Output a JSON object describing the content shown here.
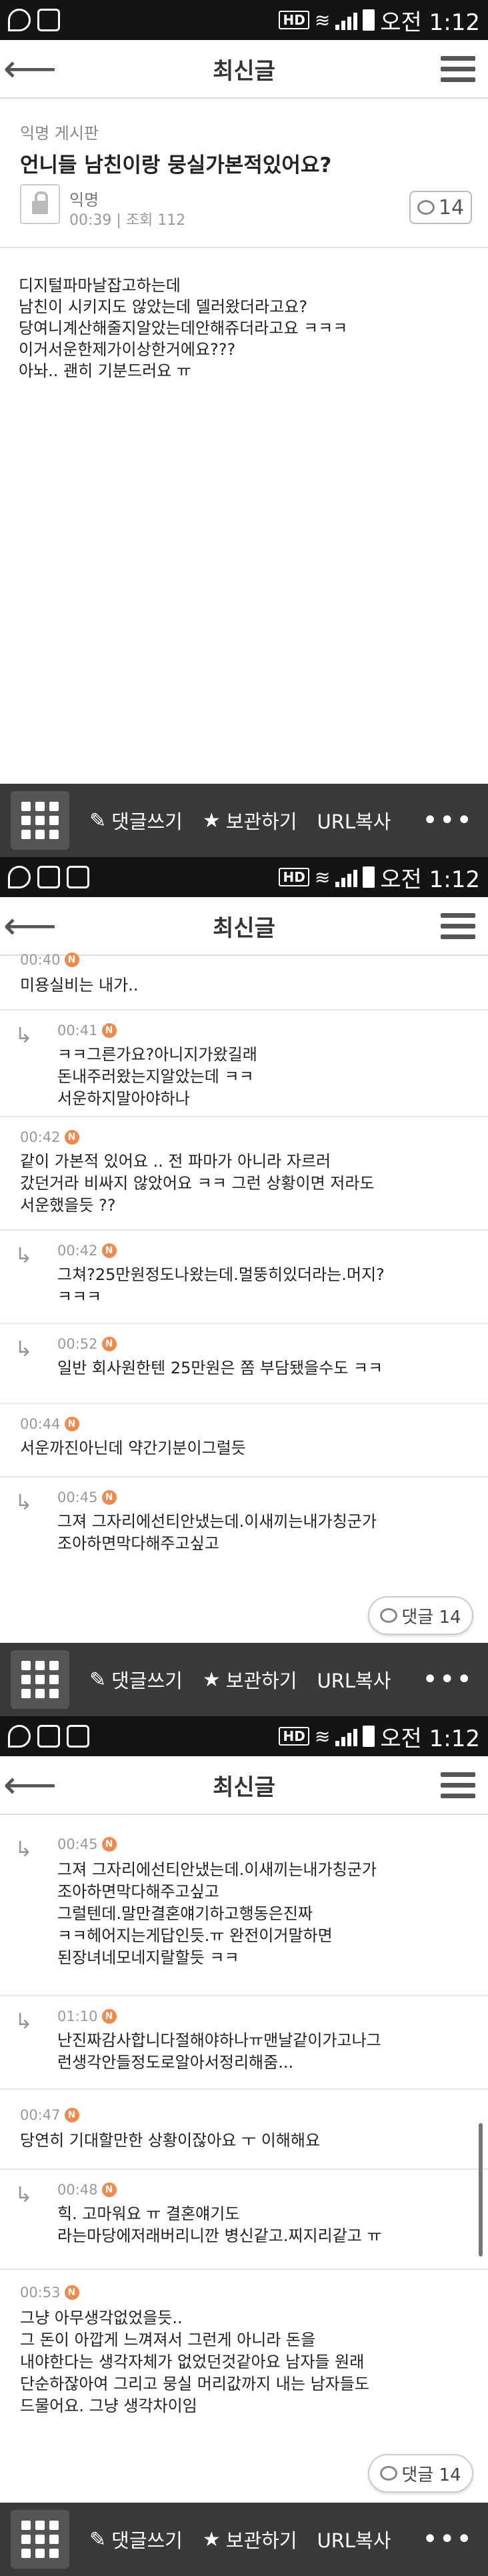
{
  "status": {
    "time": "오전 1:12",
    "hd": "HD"
  },
  "appbar": {
    "title": "최신글"
  },
  "bottombar": {
    "comment": "댓글쓰기",
    "bookmark": "보관하기",
    "url_copy": "URL복사",
    "more": "•••"
  },
  "post": {
    "board": "익명 게시판",
    "title": "언니들 남친이랑 뭉실가본적있어요?",
    "author": "익명",
    "time": "00:39",
    "views": "조회 112",
    "comment_count": "14",
    "body": "디지털파마날잡고하는데\n남친이 시키지도 않았는데 델러왔더라고요?\n당여니계산해줄지알았는데안해쥬더라고요 ㅋㅋㅋ\n이거서운한제가이상한거에요???\n아놔.. 괜히 기분드러요 ㅠ"
  },
  "screen2": {
    "partial_time": "00:40",
    "partial_text": "미용실비는 내가..",
    "comments": [
      {
        "reply": true,
        "time": "00:41",
        "text": "ㅋㅋ그른가요?아니지가왔길래\n돈내주러왔는지알았는데 ㅋㅋ\n서운하지말아야하나"
      },
      {
        "reply": false,
        "time": "00:42",
        "text": "같이 가본적 있어요 .. 전 파마가 아니라 자르러\n갔던거라 비싸지 않았어요 ㅋㅋ 그런 상황이면 저라도\n서운했을듯 ??"
      },
      {
        "reply": true,
        "time": "00:42",
        "text": "그쳐?25만원정도나왔는데.멀뚱히있더라는.머지?\nㅋㅋㅋ"
      },
      {
        "reply": true,
        "time": "00:52",
        "text": "일반 회사원한텐 25만원은 쫌 부담됐을수도 ㅋㅋ"
      },
      {
        "reply": false,
        "time": "00:44",
        "text": "서운까진아닌데 약간기분이그럴듯"
      },
      {
        "reply": true,
        "time": "00:45",
        "text": "그져 그자리에선티안냈는데.이새끼는내가칭군가\n조아하면막다해주고싶고"
      }
    ],
    "float_label": "댓글 14"
  },
  "screen3": {
    "comments": [
      {
        "reply": true,
        "time": "00:45",
        "text": "그져 그자리에선티안냈는데.이새끼는내가칭군가\n조아하면막다해주고싶고\n그럴텐데.말만결혼얘기하고행동은진짜\nㅋㅋ헤어지는게답인듯.ㅠ 완전이거말하면\n된장녀네모네지랄할듯 ㅋㅋ"
      },
      {
        "reply": true,
        "time": "01:10",
        "text": "난진짜감사합니다절해야하나ㅠ맨날같이가고나그\n런생각안들정도로알아서정리해줌..."
      },
      {
        "reply": false,
        "time": "00:47",
        "text": "당연히 기대할만한 상황이잖아요 ㅜ 이해해요"
      },
      {
        "reply": true,
        "time": "00:48",
        "text": "힉. 고마워요 ㅠ 결혼얘기도\n라는마당에저래버리니깐 병신같고.찌지리같고 ㅠ"
      },
      {
        "reply": false,
        "time": "00:53",
        "text": "그냥 아무생각없었을듯..\n그 돈이 아깝게 느껴져서 그런게 아니라 돈을\n내야한다는 생각자체가 없었던것같아요 남자들 원래\n단순하잖아여 그리고 뭉실 머리값까지 내는 남자들도\n드물어요. 그냥 생각차이임"
      }
    ],
    "float_label": "댓글 14"
  },
  "icons": {
    "back": "back-arrow-icon",
    "menu": "hamburger-menu-icon",
    "grid": "grid-icon",
    "pencil": "pencil-icon",
    "star": "star-icon",
    "lock": "lock-icon",
    "chat": "chat-bubble-icon",
    "new_badge": "N"
  }
}
